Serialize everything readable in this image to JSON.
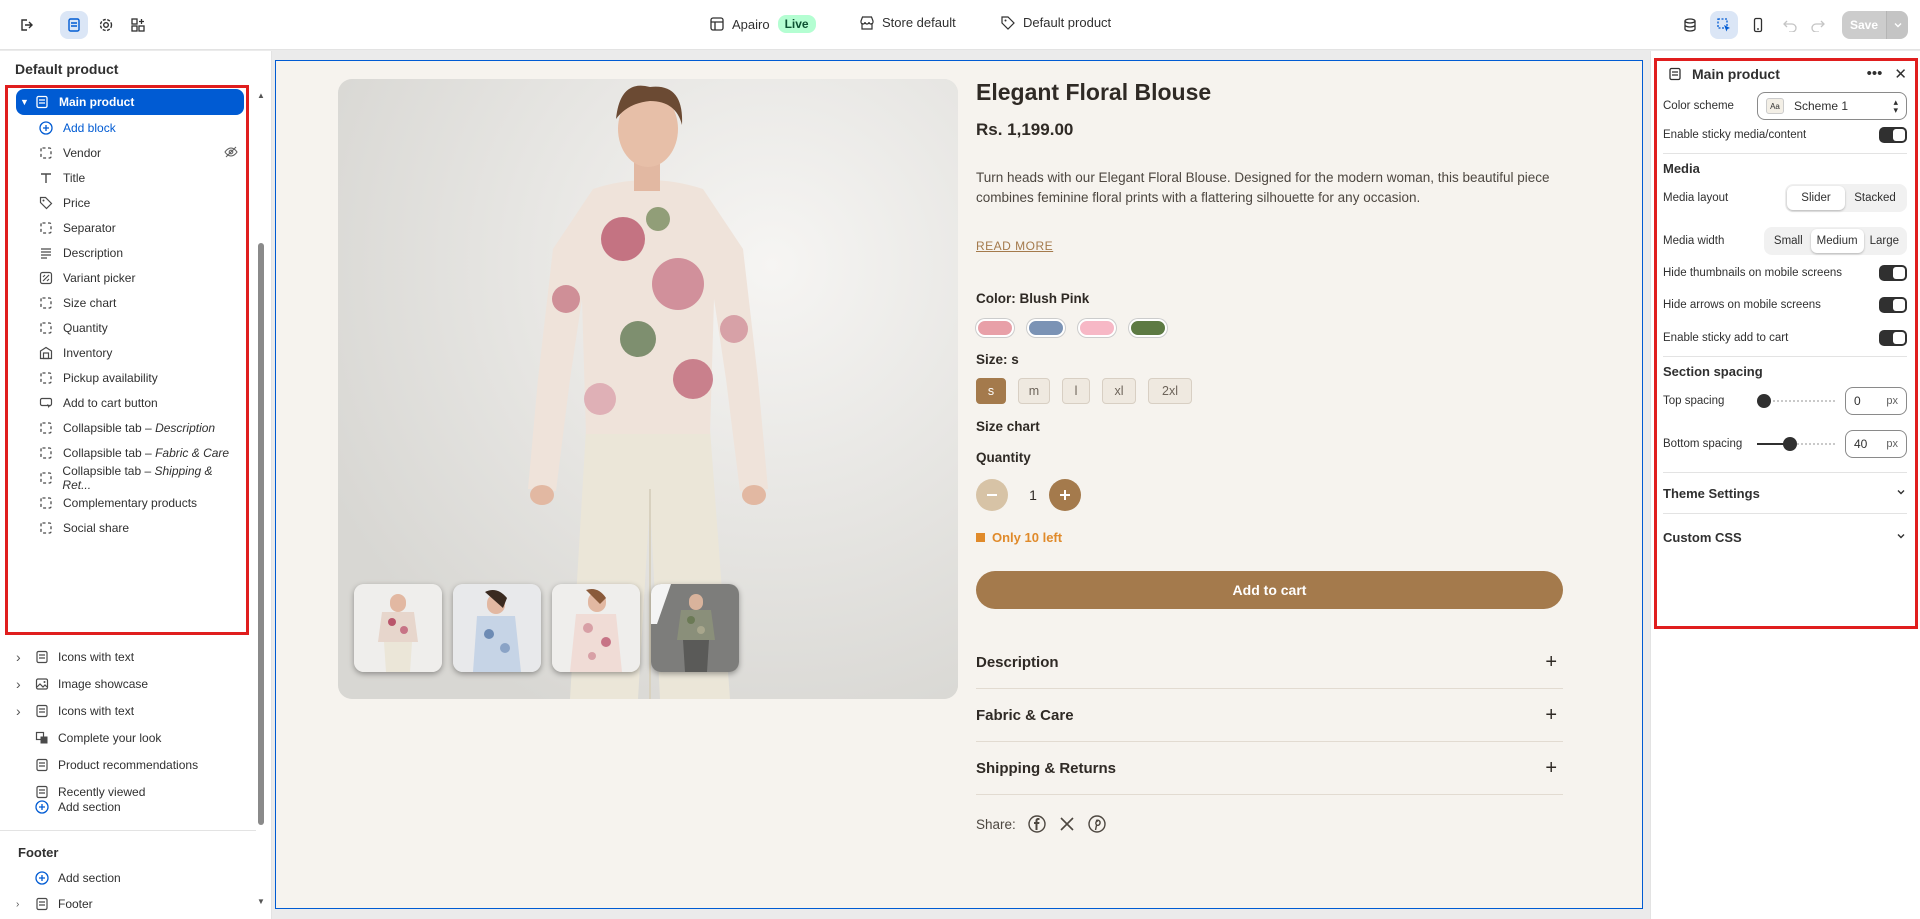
{
  "topbar": {
    "store_name": "Apairo",
    "live_badge": "Live",
    "theme_label": "Store default",
    "template_label": "Default product",
    "save_label": "Save"
  },
  "left_panel": {
    "header": "Default product",
    "selected_section": "Main product",
    "blocks": [
      {
        "label": "Add block",
        "icon": "plus-circle-icon",
        "add": true
      },
      {
        "label": "Vendor",
        "icon": "block-icon",
        "hidden": true
      },
      {
        "label": "Title",
        "icon": "text-icon"
      },
      {
        "label": "Price",
        "icon": "price-tag-icon"
      },
      {
        "label": "Separator",
        "icon": "block-icon"
      },
      {
        "label": "Description",
        "icon": "paragraph-icon"
      },
      {
        "label": "Variant picker",
        "icon": "variant-icon"
      },
      {
        "label": "Size chart",
        "icon": "block-icon"
      },
      {
        "label": "Quantity",
        "icon": "block-icon"
      },
      {
        "label": "Inventory",
        "icon": "inventory-icon"
      },
      {
        "label": "Pickup availability",
        "icon": "block-icon"
      },
      {
        "label": "Add to cart button",
        "icon": "button-icon"
      },
      {
        "label": "Collapsible tab – ",
        "suffix": "Description",
        "icon": "block-icon"
      },
      {
        "label": "Collapsible tab – ",
        "suffix": "Fabric & Care",
        "icon": "block-icon"
      },
      {
        "label": "Collapsible tab – ",
        "suffix": "Shipping & Ret...",
        "icon": "block-icon"
      },
      {
        "label": "Complementary products",
        "icon": "block-icon"
      },
      {
        "label": "Social share",
        "icon": "block-icon"
      }
    ],
    "sections": [
      {
        "label": "Icons with text",
        "icon": "section-icon",
        "expandable": true
      },
      {
        "label": "Image showcase",
        "icon": "image-icon",
        "expandable": true
      },
      {
        "label": "Icons with text",
        "icon": "section-icon",
        "expandable": true
      },
      {
        "label": "Complete your look",
        "icon": "look-icon",
        "expandable": false
      },
      {
        "label": "Product recommendations",
        "icon": "section-icon",
        "expandable": false
      },
      {
        "label": "Recently viewed",
        "icon": "section-icon",
        "expandable": false
      }
    ],
    "add_section_label": "Add section",
    "footer_title": "Footer",
    "footer_add_section_label": "Add section",
    "footer_item": "Footer"
  },
  "product": {
    "title": "Elegant Floral Blouse",
    "price": "Rs. 1,199.00",
    "description": "Turn heads with our Elegant Floral Blouse. Designed for the modern woman, this beautiful piece combines feminine floral prints with a flattering silhouette for any occasion.",
    "read_more": "READ MORE",
    "color_label": "Color: Blush Pink",
    "swatches": [
      "#e8a0a8",
      "#7b93b5",
      "#f7b8c6",
      "#5d7a43"
    ],
    "size_label": "Size: s",
    "sizes": [
      "s",
      "m",
      "l",
      "xl",
      "2xl"
    ],
    "selected_size": "s",
    "size_chart": "Size chart",
    "quantity_label": "Quantity",
    "quantity_value": "1",
    "stock_text": "Only 10 left",
    "add_to_cart": "Add to cart",
    "accordions": [
      "Description",
      "Fabric & Care",
      "Shipping & Returns"
    ],
    "share_label": "Share:"
  },
  "right_panel": {
    "title": "Main product",
    "color_scheme_label": "Color scheme",
    "color_scheme_value": "Scheme 1",
    "color_scheme_swatch": "Aa",
    "sticky_label": "Enable sticky media/content",
    "media_heading": "Media",
    "media_layout_label": "Media layout",
    "media_layout_options": [
      "Slider",
      "Stacked"
    ],
    "media_width_label": "Media width",
    "media_width_options": [
      "Small",
      "Medium",
      "Large"
    ],
    "hide_thumbs_label": "Hide thumbnails on mobile screens",
    "hide_arrows_label": "Hide arrows on mobile screens",
    "sticky_cart_label": "Enable sticky add to cart",
    "section_spacing_heading": "Section spacing",
    "top_spacing_label": "Top spacing",
    "top_spacing_value": "0",
    "bottom_spacing_label": "Bottom spacing",
    "bottom_spacing_value": "40",
    "unit": "px",
    "theme_settings": "Theme Settings",
    "custom_css": "Custom CSS"
  },
  "colors": {
    "accent": "#005bd3",
    "brand_brown": "#a47a4c",
    "stock_orange": "#e08a2a",
    "highlight_red": "#e01e1e"
  }
}
